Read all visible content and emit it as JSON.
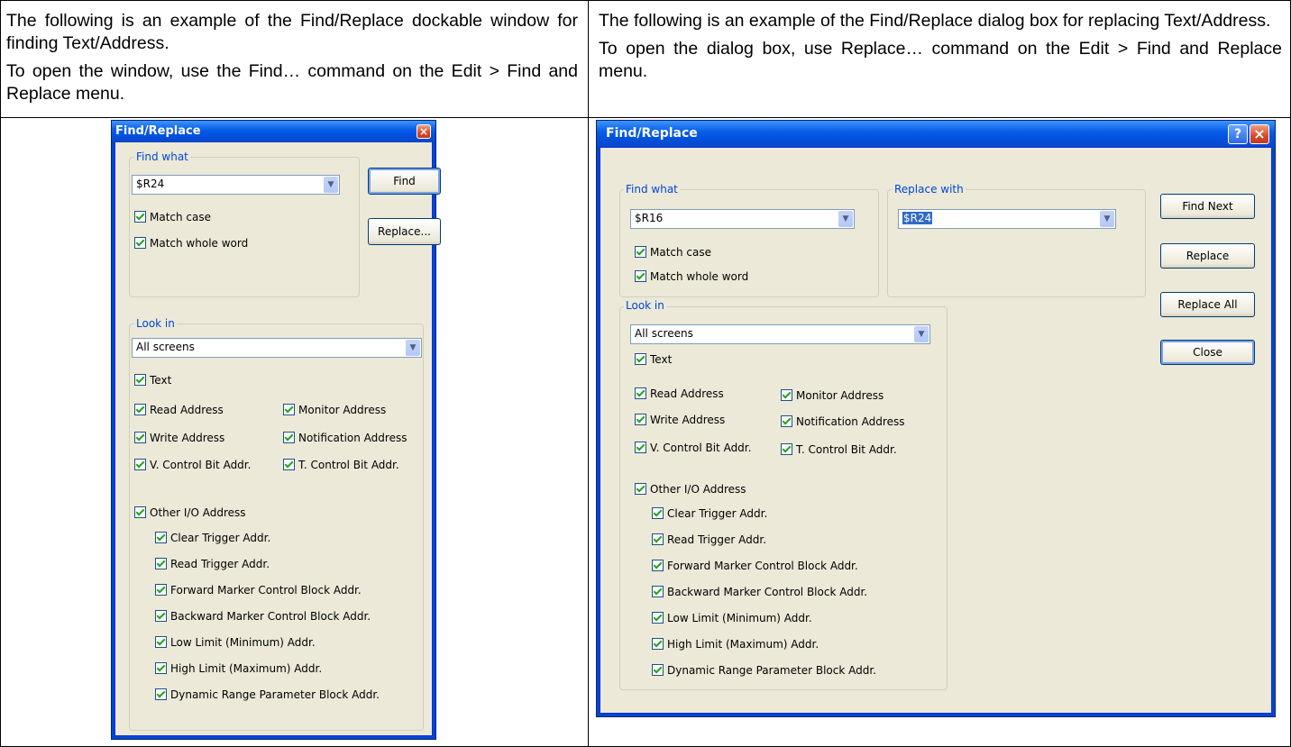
{
  "descriptions": {
    "left_p1": "The following is an example of the Find/Replace dockable window for finding Text/Address.",
    "left_p2": "To open the window, use the Find… command on the Edit > Find and Replace menu.",
    "right_p1": "The following is an example of the Find/Replace dialog box for replacing Text/Address.",
    "right_p2": "To open the dialog box, use Replace… command on the Edit > Find and Replace menu."
  },
  "find_window": {
    "title": "Find/Replace",
    "close_glyph": "×",
    "find_what_label": "Find what",
    "find_what_value": "$R24",
    "match_case": "Match case",
    "match_whole_word": "Match whole word",
    "find_button": "Find",
    "replace_button": "Replace...",
    "look_in_label": "Look in",
    "look_in_value": "All screens",
    "options": {
      "text": "Text",
      "read_address": "Read Address",
      "monitor_address": "Monitor Address",
      "write_address": "Write Address",
      "notification_address": "Notification Address",
      "v_control": "V. Control Bit Addr.",
      "t_control": "T. Control Bit Addr.",
      "other_io": "Other I/O Address",
      "clear_trigger": "Clear Trigger Addr.",
      "read_trigger": "Read Trigger Addr.",
      "forward_marker": "Forward Marker Control Block Addr.",
      "backward_marker": "Backward Marker Control Block Addr.",
      "low_limit": "Low Limit (Minimum) Addr.",
      "high_limit": "High Limit (Maximum) Addr.",
      "dynamic_range": "Dynamic Range Parameter Block Addr."
    }
  },
  "replace_dialog": {
    "title": "Find/Replace",
    "help_glyph": "?",
    "close_glyph": "×",
    "find_what_label": "Find what",
    "find_what_value": "$R16",
    "replace_with_label": "Replace with",
    "replace_with_value": "$R24",
    "match_case": "Match case",
    "match_whole_word": "Match whole word",
    "find_next_button": "Find Next",
    "replace_button": "Replace",
    "replace_all_button": "Replace All",
    "close_button": "Close",
    "look_in_label": "Look in",
    "look_in_value": "All screens",
    "options": {
      "text": "Text",
      "read_address": "Read Address",
      "monitor_address": "Monitor Address",
      "write_address": "Write Address",
      "notification_address": "Notification Address",
      "v_control": "V. Control Bit Addr.",
      "t_control": "T. Control Bit Addr.",
      "other_io": "Other I/O Address",
      "clear_trigger": "Clear Trigger Addr.",
      "read_trigger": "Read Trigger Addr.",
      "forward_marker": "Forward Marker Control Block Addr.",
      "backward_marker": "Backward Marker Control Block Addr.",
      "low_limit": "Low Limit (Minimum) Addr.",
      "high_limit": "High Limit (Maximum) Addr.",
      "dynamic_range": "Dynamic Range Parameter Block Addr."
    }
  }
}
